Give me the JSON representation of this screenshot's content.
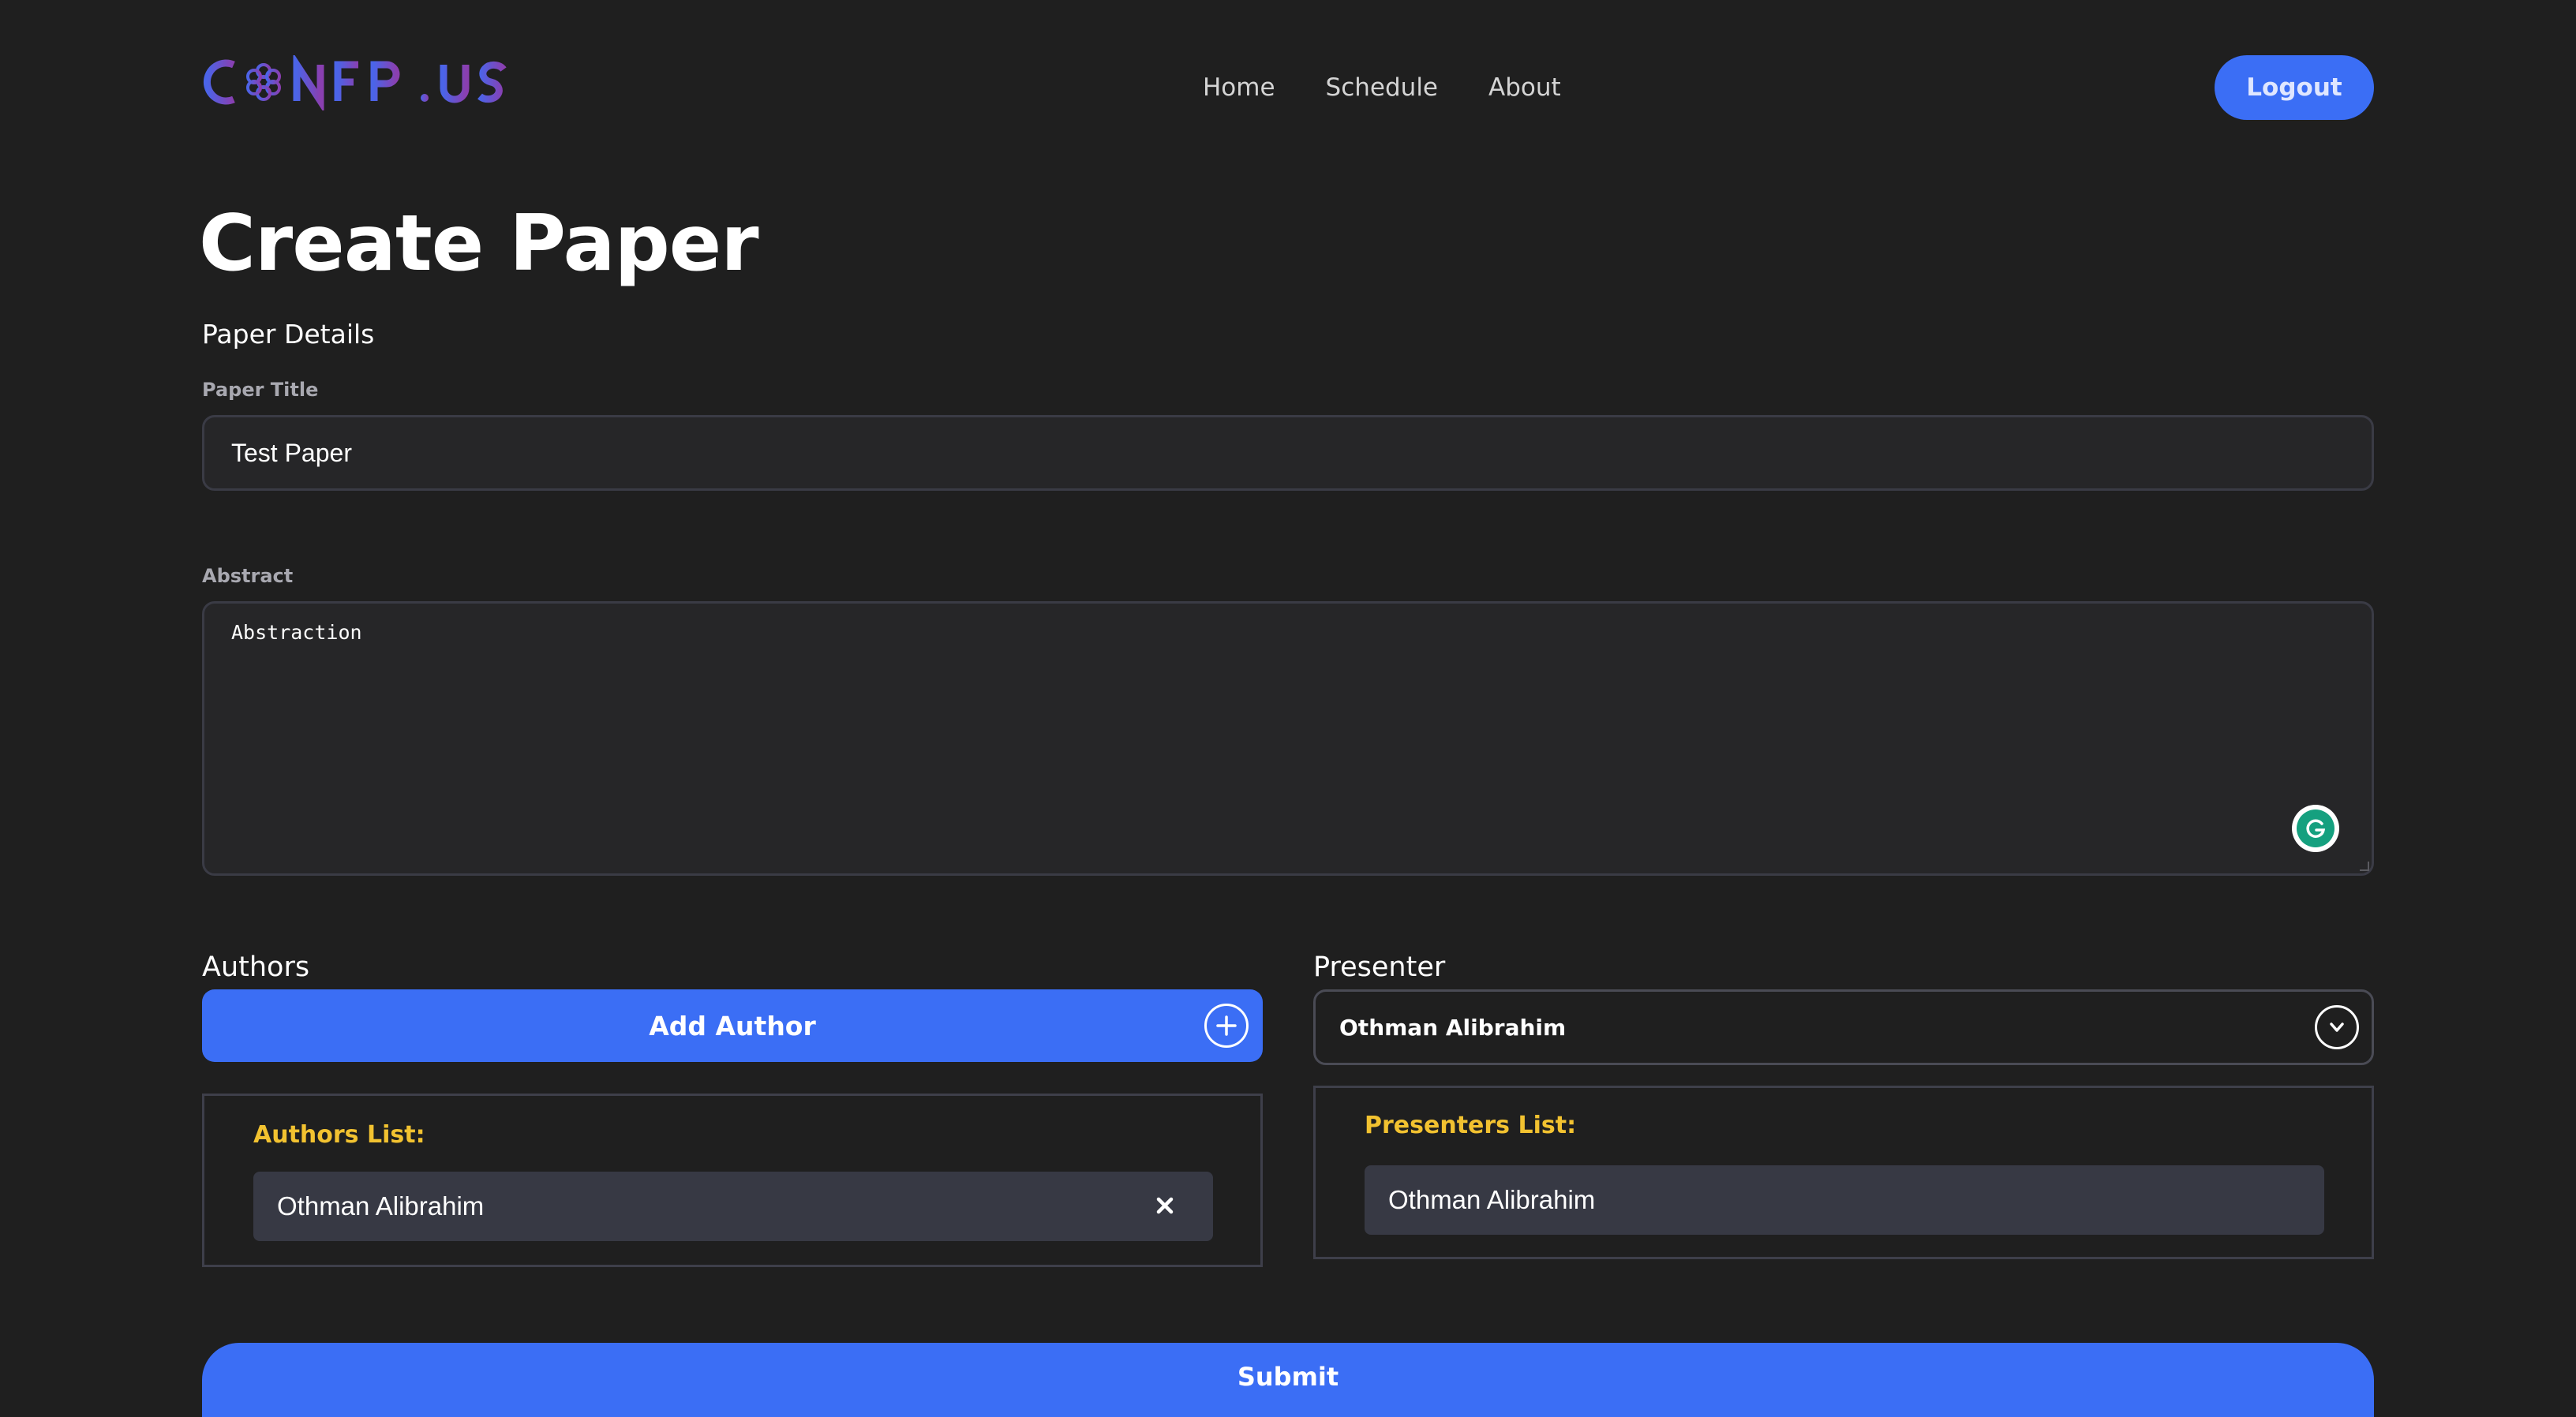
{
  "brand": {
    "logo_text": "CONFPLUS"
  },
  "nav": {
    "items": [
      "Home",
      "Schedule",
      "About"
    ]
  },
  "header": {
    "logout_label": "Logout"
  },
  "page": {
    "title": "Create Paper",
    "section_title": "Paper Details"
  },
  "form": {
    "paper_title_label": "Paper Title",
    "paper_title_value": "Test Paper",
    "abstract_label": "Abstract",
    "abstract_value": "Abstraction"
  },
  "authors": {
    "label": "Authors",
    "add_button_label": "Add Author",
    "list_title": "Authors List:",
    "items": [
      "Othman Alibrahim"
    ]
  },
  "presenter": {
    "label": "Presenter",
    "selected": "Othman Alibrahim",
    "list_title": "Presenters List:",
    "items": [
      "Othman Alibrahim"
    ]
  },
  "submit_label": "Submit",
  "colors": {
    "background": "#1f1f1f",
    "accent": "#3b6ef5",
    "list_title": "#f2c230",
    "input_bg": "#262628",
    "item_bg": "#373944"
  },
  "icons": [
    "plus-circle-icon",
    "chevron-down-circle-icon",
    "close-icon",
    "grammarly-icon"
  ]
}
